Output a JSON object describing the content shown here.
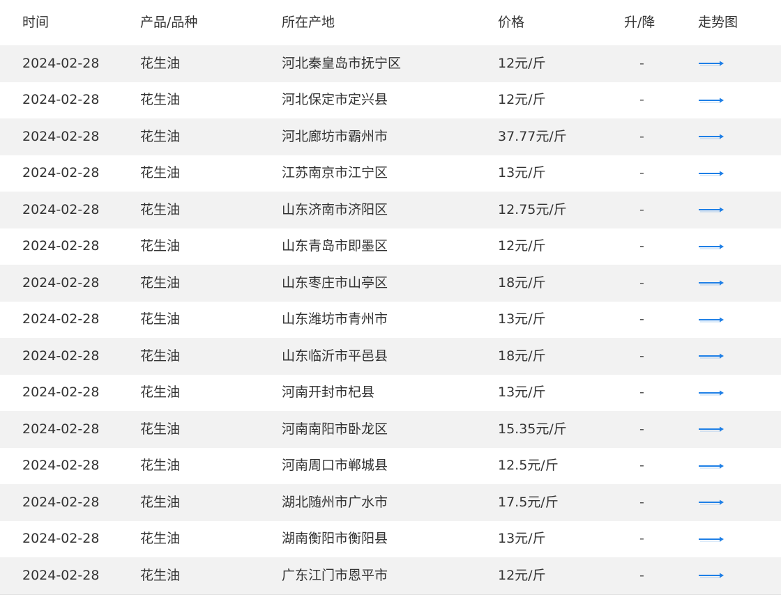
{
  "header": {
    "time": "时间",
    "product": "产品/品种",
    "origin": "所在产地",
    "price": "价格",
    "change": "升/降",
    "trend": "走势图"
  },
  "accent_color": "#1e7fe6",
  "rows": [
    {
      "time": "2024-02-28",
      "product": "花生油",
      "origin": "河北秦皇岛市抚宁区",
      "price": "12元/斤",
      "change": "-",
      "trend_icon": "arrow-right-icon"
    },
    {
      "time": "2024-02-28",
      "product": "花生油",
      "origin": "河北保定市定兴县",
      "price": "12元/斤",
      "change": "-",
      "trend_icon": "arrow-right-icon"
    },
    {
      "time": "2024-02-28",
      "product": "花生油",
      "origin": "河北廊坊市霸州市",
      "price": "37.77元/斤",
      "change": "-",
      "trend_icon": "arrow-right-icon"
    },
    {
      "time": "2024-02-28",
      "product": "花生油",
      "origin": "江苏南京市江宁区",
      "price": "13元/斤",
      "change": "-",
      "trend_icon": "arrow-right-icon"
    },
    {
      "time": "2024-02-28",
      "product": "花生油",
      "origin": "山东济南市济阳区",
      "price": "12.75元/斤",
      "change": "-",
      "trend_icon": "arrow-right-icon"
    },
    {
      "time": "2024-02-28",
      "product": "花生油",
      "origin": "山东青岛市即墨区",
      "price": "12元/斤",
      "change": "-",
      "trend_icon": "arrow-right-icon"
    },
    {
      "time": "2024-02-28",
      "product": "花生油",
      "origin": "山东枣庄市山亭区",
      "price": "18元/斤",
      "change": "-",
      "trend_icon": "arrow-right-icon"
    },
    {
      "time": "2024-02-28",
      "product": "花生油",
      "origin": "山东潍坊市青州市",
      "price": "13元/斤",
      "change": "-",
      "trend_icon": "arrow-right-icon"
    },
    {
      "time": "2024-02-28",
      "product": "花生油",
      "origin": "山东临沂市平邑县",
      "price": "18元/斤",
      "change": "-",
      "trend_icon": "arrow-right-icon"
    },
    {
      "time": "2024-02-28",
      "product": "花生油",
      "origin": "河南开封市杞县",
      "price": "13元/斤",
      "change": "-",
      "trend_icon": "arrow-right-icon"
    },
    {
      "time": "2024-02-28",
      "product": "花生油",
      "origin": "河南南阳市卧龙区",
      "price": "15.35元/斤",
      "change": "-",
      "trend_icon": "arrow-right-icon"
    },
    {
      "time": "2024-02-28",
      "product": "花生油",
      "origin": "河南周口市郸城县",
      "price": "12.5元/斤",
      "change": "-",
      "trend_icon": "arrow-right-icon"
    },
    {
      "time": "2024-02-28",
      "product": "花生油",
      "origin": "湖北随州市广水市",
      "price": "17.5元/斤",
      "change": "-",
      "trend_icon": "arrow-right-icon"
    },
    {
      "time": "2024-02-28",
      "product": "花生油",
      "origin": "湖南衡阳市衡阳县",
      "price": "13元/斤",
      "change": "-",
      "trend_icon": "arrow-right-icon"
    },
    {
      "time": "2024-02-28",
      "product": "花生油",
      "origin": "广东江门市恩平市",
      "price": "12元/斤",
      "change": "-",
      "trend_icon": "arrow-right-icon"
    }
  ]
}
